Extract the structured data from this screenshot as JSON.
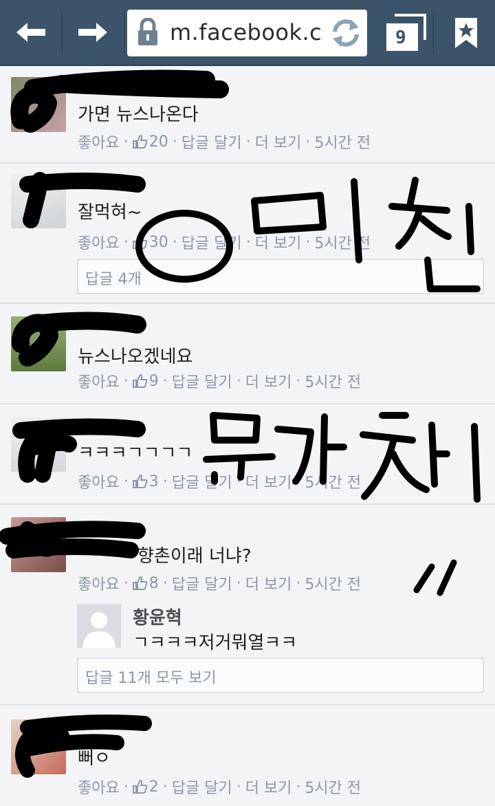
{
  "browser": {
    "url": "m.facebook.c",
    "tab_count": "9",
    "icons": [
      "back-arrow-icon",
      "forward-arrow-icon",
      "lock-icon",
      "reload-icon",
      "tabs-icon",
      "bookmark-star-icon"
    ]
  },
  "comments": [
    {
      "text": "가면 뉴스나온다",
      "like": "좋아요",
      "likes": "20",
      "reply": "답글 달기",
      "more": "더 보기",
      "time": "5시간 전"
    },
    {
      "text": "잘먹혀~",
      "like": "좋아요",
      "likes": "30",
      "reply": "답글 달기",
      "more": "더 보기",
      "time": "5시간 전",
      "replies_label": "답글 4개"
    },
    {
      "text": "뉴스나오겠네요",
      "like": "좋아요",
      "likes": "9",
      "reply": "답글 달기",
      "more": "더 보기",
      "time": "5시간 전"
    },
    {
      "text": "ㅋㅋㅋㄱㄱㄱㄱ",
      "like": "좋아요",
      "likes": "3",
      "reply": "답글 달기",
      "more": "더 보기",
      "time": "5시간 전"
    },
    {
      "text": "향촌이래 너냐?",
      "like": "좋아요",
      "likes": "8",
      "reply": "답글 달기",
      "more": "더 보기",
      "time": "5시간 전",
      "sub_reply": {
        "name": "황윤혁",
        "text": "ㄱㅋㅋㅋ저거뭐열ㅋㅋ"
      },
      "replies_label": "답글 11개 모두 보기"
    },
    {
      "text": "뻐ㅇ",
      "like": "좋아요",
      "likes": "2",
      "reply": "답글 달기",
      "more": "더 보기",
      "time": "5시간 전"
    }
  ],
  "colors": {
    "browser_bar": "#3b5469",
    "meta_text": "#8b97ab",
    "page_bg": "#f3f4f6",
    "scribble": "#000000"
  }
}
